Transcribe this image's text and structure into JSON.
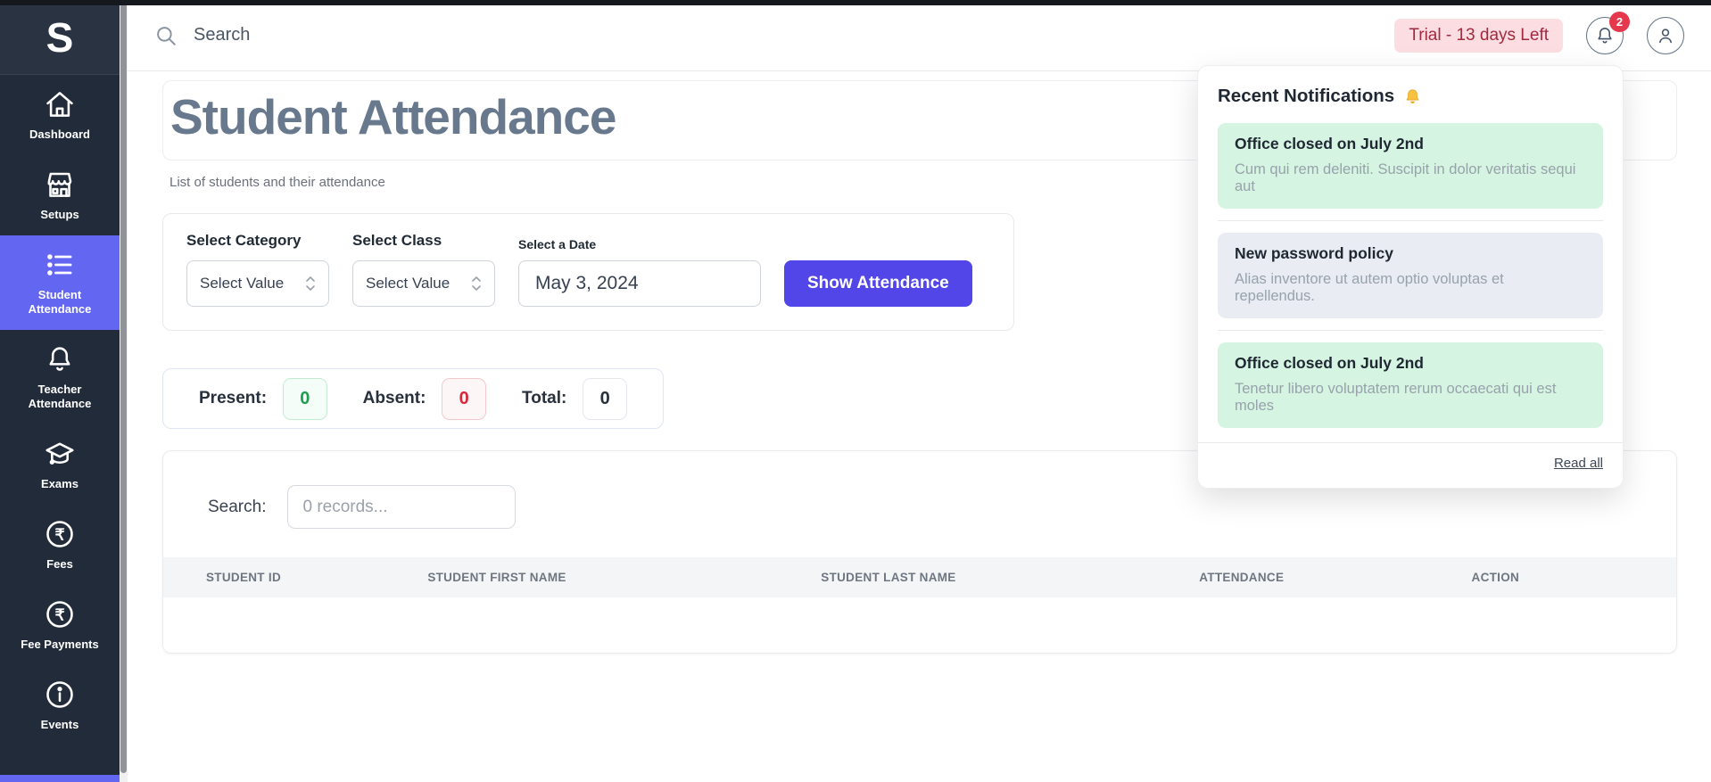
{
  "topbar": {
    "search_placeholder": "Search",
    "trial_badge": "Trial - 13 days Left",
    "notification_count": "2"
  },
  "sidebar": {
    "logo": "S",
    "items": [
      {
        "label": "Dashboard",
        "icon": "home-icon",
        "active": false
      },
      {
        "label": "Setups",
        "icon": "store-icon",
        "active": false
      },
      {
        "label": "Student Attendance",
        "icon": "list-icon",
        "active": true
      },
      {
        "label": "Teacher Attendance",
        "icon": "bell-icon",
        "active": false
      },
      {
        "label": "Exams",
        "icon": "graduation-cap-icon",
        "active": false
      },
      {
        "label": "Fees",
        "icon": "rupee-circle-icon",
        "active": false
      },
      {
        "label": "Fee Payments",
        "icon": "rupee-circle-icon",
        "active": false
      },
      {
        "label": "Events",
        "icon": "info-circle-icon",
        "active": false
      }
    ]
  },
  "page": {
    "title": "Student Attendance",
    "subtitle": "List of students and their attendance"
  },
  "filters": {
    "category_label": "Select Category",
    "category_value": "Select Value",
    "class_label": "Select Class",
    "class_value": "Select Value",
    "date_label": "Select a Date",
    "date_value": "May 3, 2024",
    "submit_label": "Show Attendance"
  },
  "stats": {
    "present_label": "Present:",
    "present_value": "0",
    "absent_label": "Absent:",
    "absent_value": "0",
    "total_label": "Total:",
    "total_value": "0"
  },
  "table": {
    "search_label": "Search:",
    "search_placeholder": "0 records...",
    "columns": [
      "Student ID",
      "Student First Name",
      "Student Last Name",
      "Attendance",
      "Action"
    ],
    "rows": []
  },
  "notifications": {
    "title": "Recent Notifications",
    "title_icon": "gold-bell-icon",
    "read_all": "Read all",
    "items": [
      {
        "title": "Office closed on July 2nd",
        "desc": "Cum qui rem deleniti. Suscipit in dolor veritatis sequi aut",
        "variant": "success"
      },
      {
        "title": "New password policy",
        "desc": "Alias inventore ut autem optio voluptas et repellendus.",
        "variant": "neutral"
      },
      {
        "title": "Office closed on July 2nd",
        "desc": "Tenetur libero voluptatem rerum occaecati qui est moles",
        "variant": "success"
      }
    ]
  },
  "colors": {
    "sidebar_bg": "#222b39",
    "active_nav": "#6366f1",
    "primary_button": "#5246e8",
    "trial_badge_bg": "#fbdde2",
    "trial_badge_text": "#a3293e",
    "notification_badge": "#e5384c",
    "present_green": "#1d9e50",
    "absent_red": "#d62839",
    "notif_success_bg": "#d5f4e1",
    "notif_neutral_bg": "#e9edf3",
    "heading_text": "#68798e"
  }
}
